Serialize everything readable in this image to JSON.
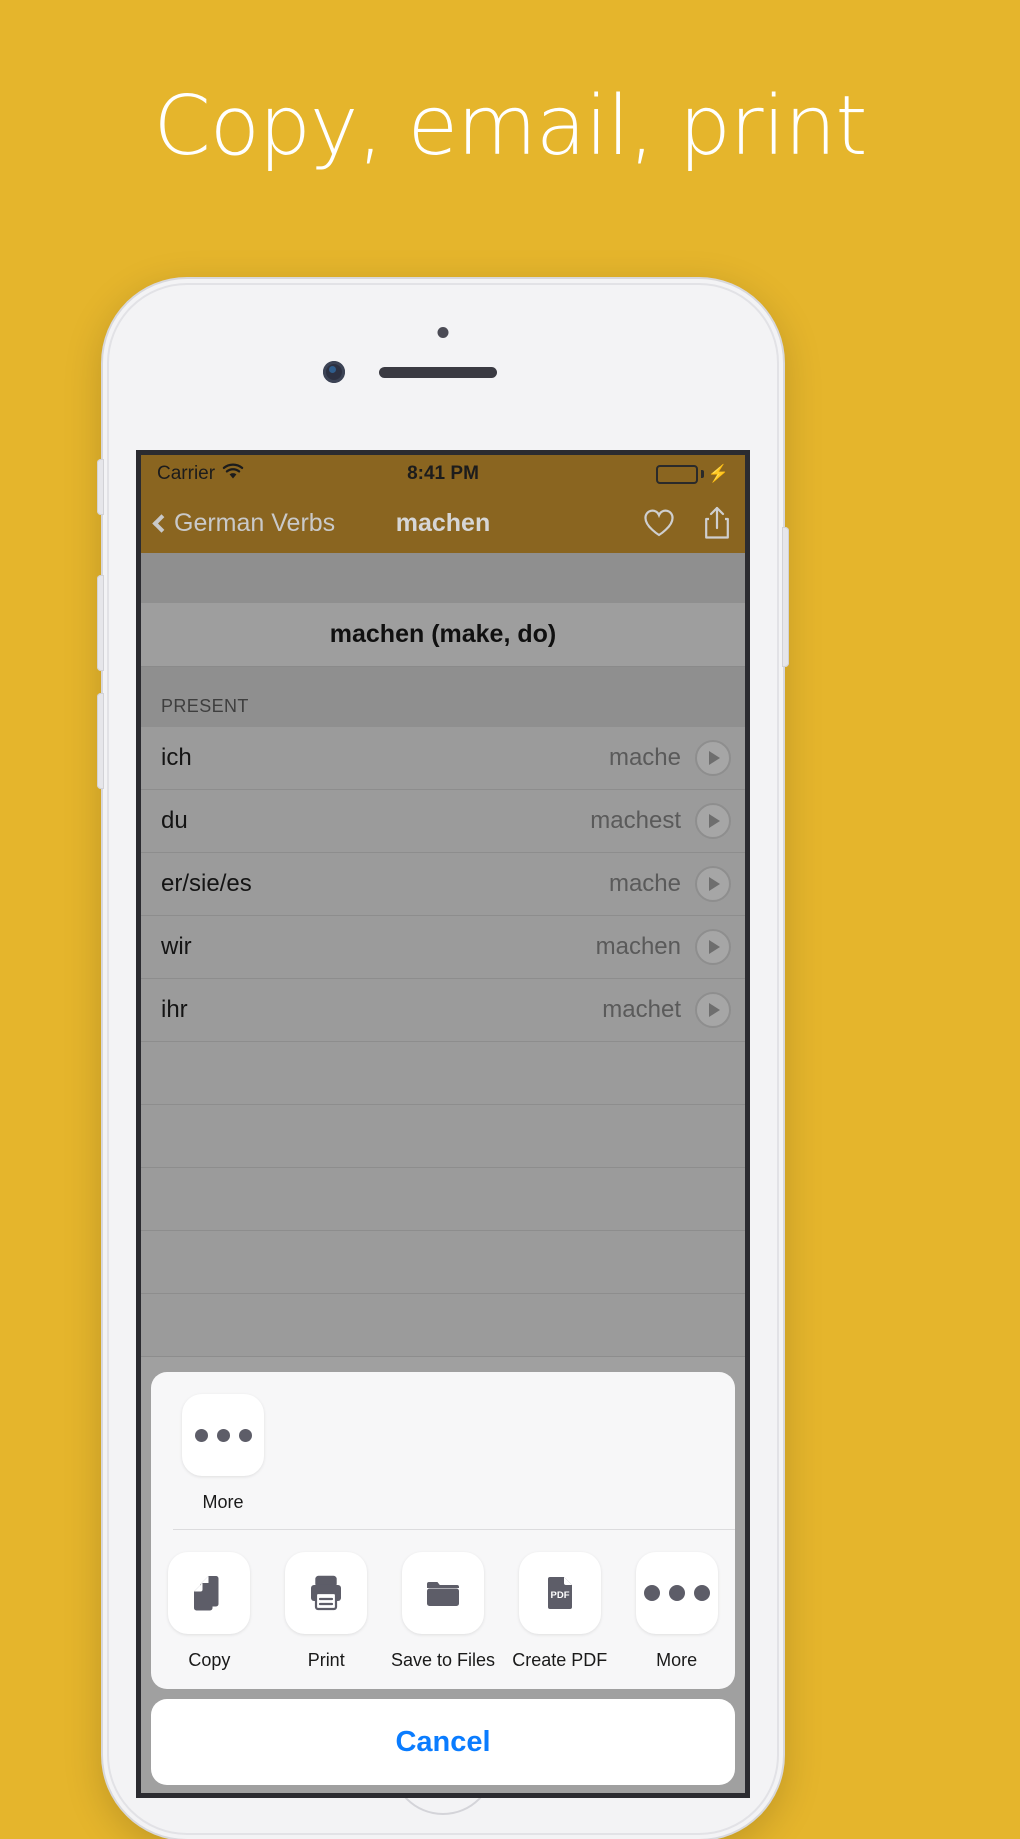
{
  "page": {
    "headline": "Copy, email, print",
    "background_color": "#e5b52c"
  },
  "status_bar": {
    "carrier": "Carrier",
    "wifi_icon": "wifi-icon",
    "time": "8:41 PM",
    "battery_icon": "battery-icon",
    "charging_icon": "lightning-bolt-icon"
  },
  "nav_bar": {
    "back_label": "German Verbs",
    "back_icon": "chevron-left-icon",
    "title": "machen",
    "favorite_icon": "heart-icon",
    "share_icon": "share-upload-icon"
  },
  "content": {
    "verb_title": "machen (make, do)",
    "section_header": "PRESENT",
    "rows": [
      {
        "pronoun": "ich",
        "form": "mache",
        "play_icon": "play-circle-icon"
      },
      {
        "pronoun": "du",
        "form": "machest",
        "play_icon": "play-circle-icon"
      },
      {
        "pronoun": "er/sie/es",
        "form": "mache",
        "play_icon": "play-circle-icon"
      },
      {
        "pronoun": "wir",
        "form": "machen",
        "play_icon": "play-circle-icon"
      },
      {
        "pronoun": "ihr",
        "form": "machet",
        "play_icon": "play-circle-icon"
      }
    ]
  },
  "share_sheet": {
    "apps": [
      {
        "label": "More",
        "icon": "ellipsis-icon"
      }
    ],
    "actions": [
      {
        "label": "Copy",
        "icon": "copy-documents-icon"
      },
      {
        "label": "Print",
        "icon": "printer-icon"
      },
      {
        "label": "Save to Files",
        "icon": "folder-icon"
      },
      {
        "label": "Create PDF",
        "icon": "pdf-document-icon"
      },
      {
        "label": "More",
        "icon": "ellipsis-icon"
      }
    ],
    "cancel_label": "Cancel",
    "cancel_color": "#0a7cff"
  }
}
